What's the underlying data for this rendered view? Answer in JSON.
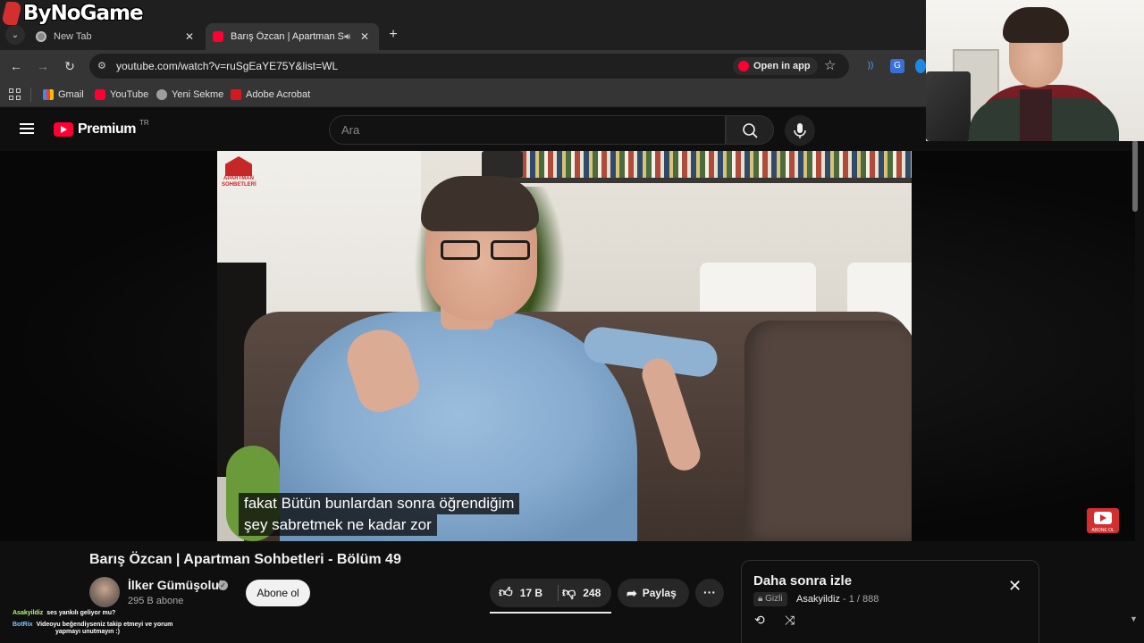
{
  "stream": {
    "logo_text": "ByNoGame"
  },
  "browser": {
    "tabs": [
      {
        "label": "New Tab",
        "active": false
      },
      {
        "label": "Barış Özcan | Apartman Soh",
        "active": true,
        "audio": true
      }
    ],
    "url": "youtube.com/watch?v=ruSgEaYE75Y&list=WL",
    "open_in_app": "Open in app",
    "bookmarks": [
      {
        "label": "Gmail",
        "icon": "gmail-icon"
      },
      {
        "label": "YouTube",
        "icon": "youtube-icon"
      },
      {
        "label": "Yeni Sekme",
        "icon": "globe-icon"
      },
      {
        "label": "Adobe Acrobat",
        "icon": "acrobat-icon"
      }
    ]
  },
  "youtube": {
    "logo_word": "Premium",
    "country_code": "TR",
    "search_placeholder": "Ara",
    "video": {
      "channel_logo_text": "APARTMAN SOHBETLERİ",
      "subtitle_line1": "fakat Bütün bunlardan sonra öğrendiğim",
      "subtitle_line2": "şey sabretmek ne kadar zor",
      "abone_badge": "ABONE OL",
      "title": "Barış Özcan | Apartman Sohbetleri - Bölüm 49"
    },
    "owner": {
      "name": "İlker Gümüşoluk",
      "subscribers": "295 B abone",
      "subscribe_label": "Abone ol"
    },
    "actions": {
      "likes": "17 B",
      "dislikes": "248",
      "share_label": "Paylaş",
      "more_label": "···"
    },
    "playlist": {
      "title": "Daha sonra izle",
      "privacy": "Gizli",
      "owner": "Asakyildiz",
      "position": "- 1 / 888"
    }
  },
  "chat": [
    {
      "user": "Asakyildiz",
      "text": "ses yankılı geliyor mu?"
    },
    {
      "user": "BotRix",
      "text": "Videoyu beğendiyseniz takip etmeyi ve yorum",
      "cont": "yapmayı unutmayın :)"
    }
  ],
  "colors": {
    "yt_red": "#ff0033",
    "bg": "#0f0f0f",
    "chrome_bar": "#353535"
  }
}
